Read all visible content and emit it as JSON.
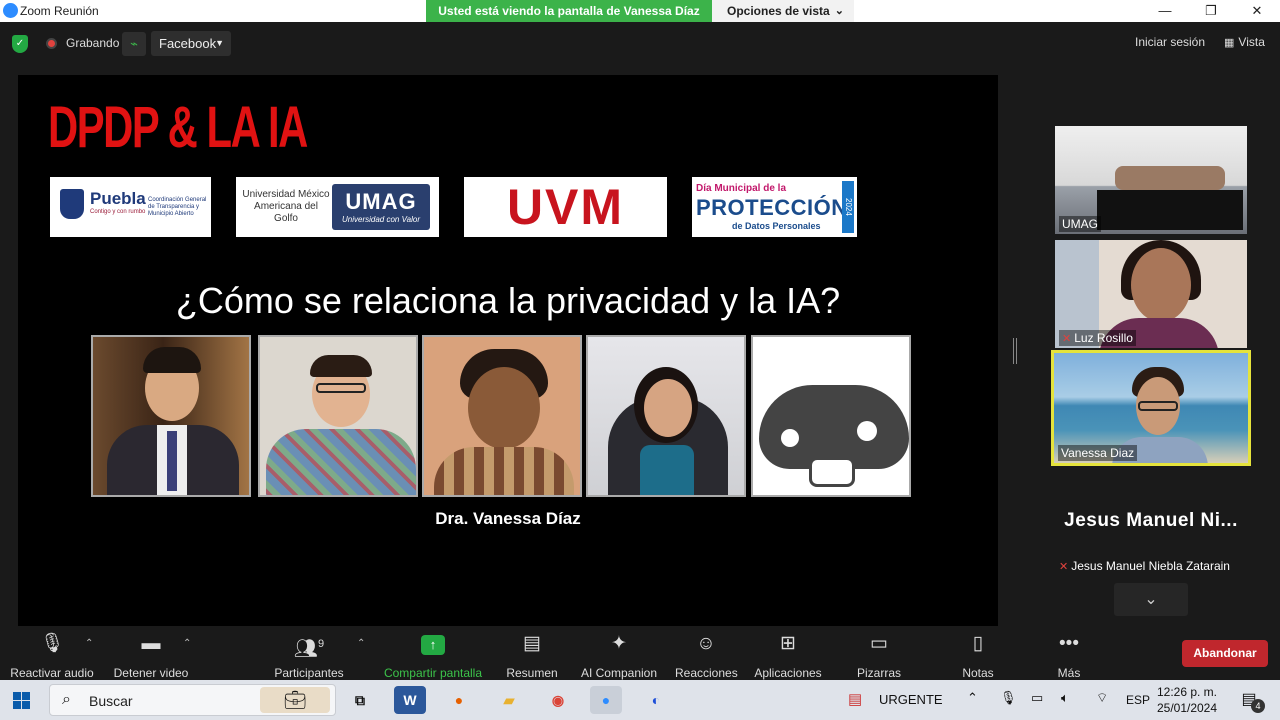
{
  "window": {
    "title": "Zoom Reunión",
    "share_notice": "Usted está viendo la pantalla de Vanessa Díaz",
    "view_options": "Opciones de vista",
    "minimize": "—",
    "restore": "❐",
    "close": "✕"
  },
  "meeting_bar": {
    "recording_label": "Grabando",
    "stream_target": "Facebook",
    "login_label": "Iniciar sesión",
    "view_label": "Vista"
  },
  "slide": {
    "title": "DPDP & LA IA",
    "logos": {
      "puebla_name": "Puebla",
      "puebla_tagline": "Contigo y con rumbo",
      "puebla_right": "Coordinación General de Transparencia y Municipio Abierto",
      "umag_text": "Universidad México Americana del Golfo",
      "umag_badge": "UMAG",
      "umag_tagline": "Universidad con Valor",
      "uvm": "UVM",
      "dia_line1": "Día Municipal de la",
      "dia_line2": "PROTECCIÓN",
      "dia_line3": "de Datos Personales",
      "dia_year": "2024"
    },
    "question": "¿Cómo se relaciona la privacidad y la IA?",
    "caption": "Dra. Vanessa Díaz"
  },
  "gallery": {
    "tiles": [
      {
        "name": "UMAG"
      },
      {
        "name": "Luz Rosillo"
      },
      {
        "name": "Vanessa Diaz"
      }
    ],
    "jesus_big": "Jesus Manuel Ni...",
    "jesus_full": "Jesus Manuel Niebla Zatarain"
  },
  "toolbar": {
    "audio": "Reactivar audio",
    "video": "Detener video",
    "participants": "Participantes",
    "participants_count": "9",
    "share": "Compartir pantalla",
    "summary": "Resumen",
    "ai": "AI Companion",
    "reactions": "Reacciones",
    "apps": "Aplicaciones",
    "whiteboards": "Pizarras",
    "notes": "Notas",
    "more": "Más",
    "leave": "Abandonar"
  },
  "taskbar": {
    "search": "Buscar",
    "urgent": "URGENTE",
    "lang": "ESP",
    "time": "12:26 p. m.",
    "date": "25/01/2024",
    "notifications": "4"
  },
  "colors": {
    "zoom_blue": "#2d8cff",
    "share_green": "#3cb34a",
    "leave_red": "#c0272d",
    "active_speaker": "#e5e33c",
    "slide_title_red": "#e01212"
  }
}
